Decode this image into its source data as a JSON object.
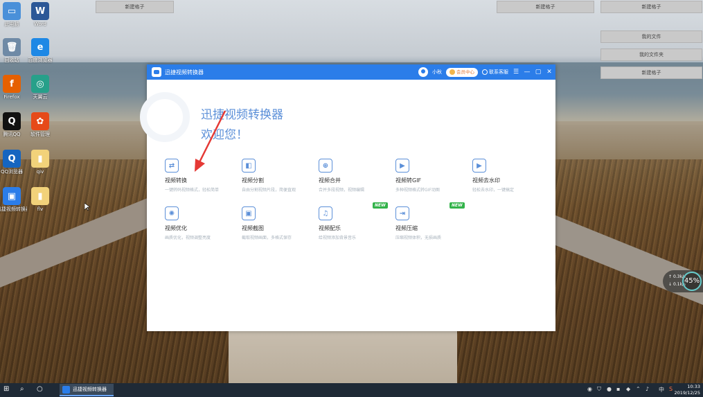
{
  "desktop": {
    "icons": [
      {
        "label": "此电脑",
        "glyph": "▭",
        "color": "#4a90d9"
      },
      {
        "label": "Word",
        "glyph": "W",
        "color": "#2b5797"
      },
      {
        "label": "回收站",
        "glyph": "🗑",
        "color": "#6f8aa6"
      },
      {
        "label": "百度浏览器",
        "glyph": "e",
        "color": "#1e88e5"
      },
      {
        "label": "Firefox",
        "glyph": "f",
        "color": "#e66000"
      },
      {
        "label": "天翼云",
        "glyph": "◎",
        "color": "#27a08a"
      },
      {
        "label": "腾讯QQ",
        "glyph": "Q",
        "color": "#111111"
      },
      {
        "label": "软件管理",
        "glyph": "✿",
        "color": "#e64a19"
      },
      {
        "label": "QQ浏览器",
        "glyph": "Q",
        "color": "#1565c0"
      },
      {
        "label": "qiv",
        "glyph": "▮",
        "color": "#f2d27a"
      },
      {
        "label": "迅捷视频转换器",
        "glyph": "▣",
        "color": "#2b7de9"
      },
      {
        "label": "flv",
        "glyph": "▮",
        "color": "#f2d27a"
      }
    ],
    "top_bars": [
      "新建格子",
      "新建格子",
      "新建格子",
      "我的文件",
      "我的文件夹",
      "新建格子"
    ]
  },
  "window": {
    "title": "迅捷视频转换器",
    "user_name": "小秋",
    "vip_label": "会员中心",
    "contact_label": "联系客服",
    "menu_glyph": "☰",
    "minimize_glyph": "—",
    "maximize_glyph": "▢",
    "close_glyph": "✕"
  },
  "hero": {
    "line1": "迅捷视频转换器",
    "line2": "欢迎您！"
  },
  "tools": [
    {
      "name": "视频转换",
      "desc": "一键转码视频格式，轻松简单",
      "glyph": "⇄",
      "new": false
    },
    {
      "name": "视频分割",
      "desc": "自由分割视频片段，简便直观",
      "glyph": "◧",
      "new": false
    },
    {
      "name": "视频合并",
      "desc": "合并多段视频，视频编辑",
      "glyph": "⊕",
      "new": false
    },
    {
      "name": "视频转GIF",
      "desc": "多种视频格式转GIF动图",
      "glyph": "▶",
      "new": false
    },
    {
      "name": "视频去水印",
      "desc": "轻松去水印，一键搞定",
      "glyph": "▶",
      "new": false
    },
    {
      "name": "视频优化",
      "desc": "画质优化，视频调整亮度",
      "glyph": "✺",
      "new": false
    },
    {
      "name": "视频截图",
      "desc": "截取视频画面，多格式保存",
      "glyph": "▣",
      "new": false
    },
    {
      "name": "视频配乐",
      "desc": "给视频添加背景音乐",
      "glyph": "♫",
      "new": true
    },
    {
      "name": "视频压缩",
      "desc": "压缩视频体积，无损画质",
      "glyph": "⇥",
      "new": true
    }
  ],
  "new_badge": "NEW",
  "network": {
    "up": "0.3k/s",
    "down": "0.1k/s",
    "percent": "45%"
  },
  "taskbar": {
    "start_glyph": "⊞",
    "search_glyph": "⌕",
    "cortana_glyph": "○",
    "app_label": "迅捷视频转换器",
    "ime": "中",
    "time": "10:33",
    "date": "2019/12/25"
  }
}
